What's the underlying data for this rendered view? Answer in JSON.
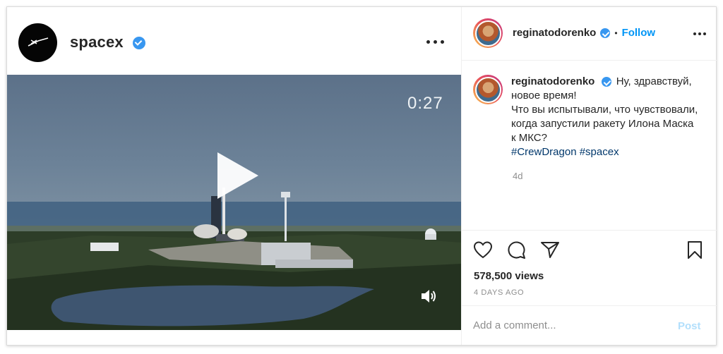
{
  "video_post": {
    "account": "spacex",
    "verified": true,
    "timer": "0:27",
    "icons": {
      "avatar": "spacex-logo",
      "verified": "verified-badge-icon",
      "more": "more-options-icon",
      "play": "play-icon",
      "sound": "volume-icon"
    }
  },
  "sidebar": {
    "username": "reginatodorenko",
    "separator": "•",
    "follow_label": "Follow",
    "caption": {
      "author": "reginatodorenko",
      "text_1": "Ну, здравствуй,",
      "text_2": "новое время!",
      "text_3": "Что вы испытывали, что чувствовали,",
      "text_4": "когда запустили ракету Илона Маска",
      "text_5": "к МКС?",
      "hashtag_1": "#CrewDragon",
      "hashtag_2": "#spacex",
      "age": "4d"
    },
    "views": "578,500 views",
    "date": "4 DAYS AGO",
    "comment_placeholder": "Add a comment...",
    "post_label": "Post",
    "colors": {
      "accent": "#0095f6",
      "post_disabled": "#b2dffc",
      "hashtag": "#00376b",
      "verified": "#3897f0"
    }
  }
}
